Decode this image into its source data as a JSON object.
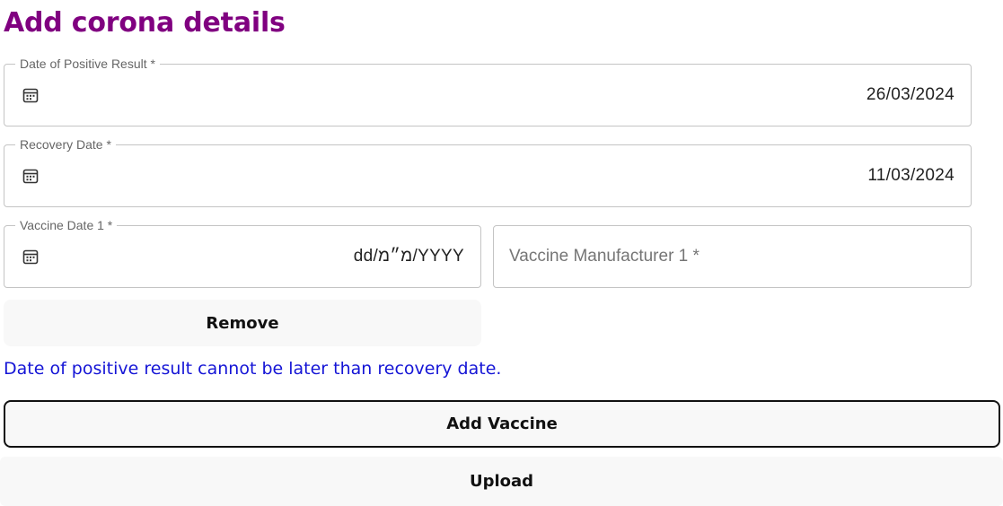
{
  "page": {
    "title": "Add corona details"
  },
  "form": {
    "positive_date": {
      "label": "Date of Positive Result *",
      "value": "26/03/2024",
      "icon": "calendar-icon"
    },
    "recovery_date": {
      "label": "Recovery Date *",
      "value": "11/03/2024",
      "icon": "calendar-icon"
    },
    "vaccines": [
      {
        "date_label": "Vaccine Date 1 *",
        "date_value": "dd/מ״מ/YYYY",
        "manufacturer_placeholder": "Vaccine Manufacturer 1 *",
        "remove_label": "Remove"
      }
    ],
    "error_message": "Date of positive result cannot be later than recovery date.",
    "add_vaccine_label": "Add Vaccine",
    "upload_label": "Upload"
  },
  "colors": {
    "title": "#800080",
    "error": "#1515d6",
    "border": "#c4c4c4",
    "button_bg": "#f8f8f8"
  }
}
